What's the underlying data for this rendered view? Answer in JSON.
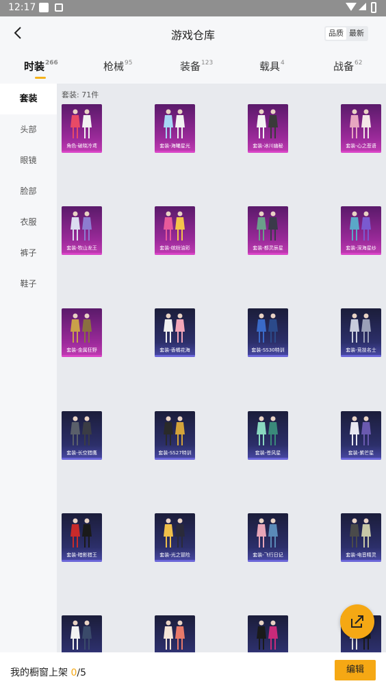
{
  "statusbar": {
    "time": "12:17"
  },
  "header": {
    "title": "游戏仓库",
    "sort_options": [
      "品质",
      "最新"
    ],
    "selected_sort": "品质"
  },
  "tabs": [
    {
      "label": "时装",
      "count": "266"
    },
    {
      "label": "枪械",
      "count": "95"
    },
    {
      "label": "装备",
      "count": "123"
    },
    {
      "label": "载具",
      "count": "4"
    },
    {
      "label": "战备",
      "count": "62"
    }
  ],
  "sidebar": {
    "items": [
      "套装",
      "头部",
      "眼镜",
      "脸部",
      "衣服",
      "裤子",
      "鞋子"
    ],
    "active": "套装"
  },
  "content": {
    "count_label": "套装: 71件",
    "items": [
      {
        "name": "角色-破晓冷鸢",
        "tier": "purple",
        "colors": [
          "#e84a66",
          "#f2f2f2"
        ]
      },
      {
        "name": "套装-海曦星光",
        "tier": "purple",
        "colors": [
          "#a7d7f5",
          "#f2f2f2"
        ]
      },
      {
        "name": "套装-冰川幽秘",
        "tier": "purple",
        "colors": [
          "#f4f4f4",
          "#3a3a3a"
        ]
      },
      {
        "name": "套装-心之悲语",
        "tier": "purple",
        "colors": [
          "#e7a6c0",
          "#f4e6e8"
        ]
      },
      {
        "name": "套装-牧山龙王",
        "tier": "purple",
        "colors": [
          "#dcdcf0",
          "#8d7cd0"
        ]
      },
      {
        "name": "套装-缤纷油彩",
        "tier": "purple",
        "colors": [
          "#e85a9a",
          "#f5c44a"
        ]
      },
      {
        "name": "套装-都灵辰星",
        "tier": "purple",
        "colors": [
          "#6aa08a",
          "#3a3a4a"
        ]
      },
      {
        "name": "套装-深海星纱",
        "tier": "purple",
        "colors": [
          "#5aa8c8",
          "#7a5ad0"
        ]
      },
      {
        "name": "套装-金属狂野",
        "tier": "purple",
        "colors": [
          "#c9a04a",
          "#8a7040"
        ]
      },
      {
        "name": "套装-香橘花海",
        "tier": "blue",
        "colors": [
          "#f0f0f0",
          "#f3a6b8"
        ]
      },
      {
        "name": "套装-SS30特训",
        "tier": "blue",
        "colors": [
          "#3a6ac8",
          "#2b4a8a"
        ]
      },
      {
        "name": "套装-竞技名士",
        "tier": "blue",
        "colors": [
          "#c8ccdc",
          "#9aa0b8"
        ]
      },
      {
        "name": "套装-长空猎鹰",
        "tier": "blue",
        "colors": [
          "#5a5f6a",
          "#3a3c44"
        ]
      },
      {
        "name": "套装-SS27特训",
        "tier": "blue",
        "colors": [
          "#2a2a2a",
          "#d4a43a"
        ]
      },
      {
        "name": "套装-苍风星",
        "tier": "blue",
        "colors": [
          "#8ad8c0",
          "#3a8a7a"
        ]
      },
      {
        "name": "套装-紫芒星",
        "tier": "blue",
        "colors": [
          "#e8e8f2",
          "#6a5ab0"
        ]
      },
      {
        "name": "套装-暗影猎王",
        "tier": "blue",
        "colors": [
          "#c82a2a",
          "#1a1a1a"
        ]
      },
      {
        "name": "套装-光之冒险",
        "tier": "blue",
        "colors": [
          "#f0c04a",
          "#2a2a3a"
        ]
      },
      {
        "name": "套装-飞行日记",
        "tier": "blue",
        "colors": [
          "#e8a6b8",
          "#5a8ab8"
        ]
      },
      {
        "name": "套装-电音精灵",
        "tier": "blue",
        "colors": [
          "#4a4a4a",
          "#c8c8a8"
        ]
      },
      {
        "name": "",
        "tier": "blue",
        "colors": [
          "#f2f2f2",
          "#3a4a6a"
        ]
      },
      {
        "name": "",
        "tier": "blue",
        "colors": [
          "#f4e6d8",
          "#e87a6a"
        ]
      },
      {
        "name": "",
        "tier": "blue",
        "colors": [
          "#1a1a1a",
          "#c82a7a"
        ]
      },
      {
        "name": "",
        "tier": "blue",
        "colors": [
          "#e0e0e0",
          "#1a1a1a"
        ]
      }
    ]
  },
  "footer": {
    "label": "我的橱窗上架 ",
    "current": "0",
    "total": "/5",
    "edit_label": "编辑"
  },
  "theme": {
    "accent": "#f5a814"
  }
}
